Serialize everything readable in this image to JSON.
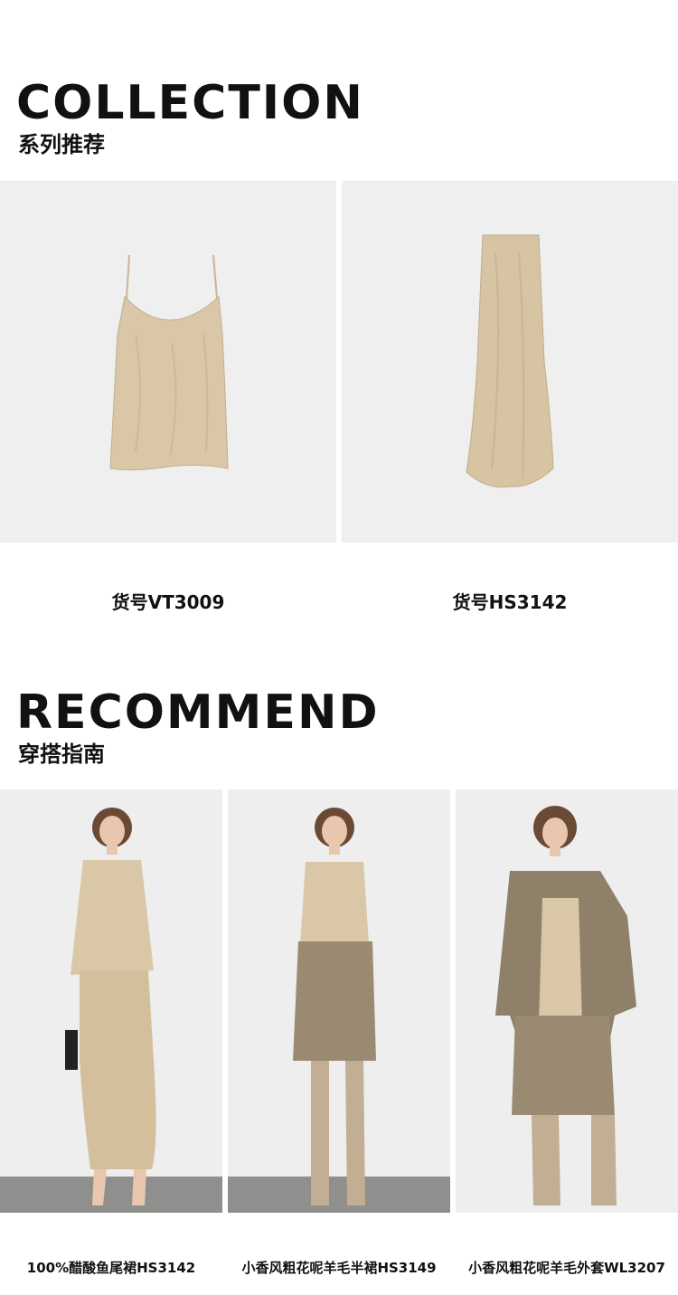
{
  "collection": {
    "title": "COLLECTION",
    "subtitle": "系列推荐",
    "items": [
      {
        "label": "货号VT3009",
        "kind": "camisole"
      },
      {
        "label": "货号HS3142",
        "kind": "slip-skirt"
      }
    ]
  },
  "recommend": {
    "title": "RECOMMEND",
    "subtitle": "穿搭指南",
    "looks": [
      {
        "label": "100%醋酸鱼尾裙HS3142"
      },
      {
        "label": "小香风粗花呢羊毛半裙HS3149"
      },
      {
        "label": "小香风粗花呢羊毛外套WL3207"
      }
    ]
  },
  "colors": {
    "satin": "#d9c6a6",
    "satin_shadow": "#bfa885",
    "tweed": "#9a8a72",
    "panel_bg": "#efefef",
    "floor": "#8e8e8c",
    "boots": "#c2ae92",
    "hair": "#6a4a34",
    "skin": "#e8c7ae"
  }
}
